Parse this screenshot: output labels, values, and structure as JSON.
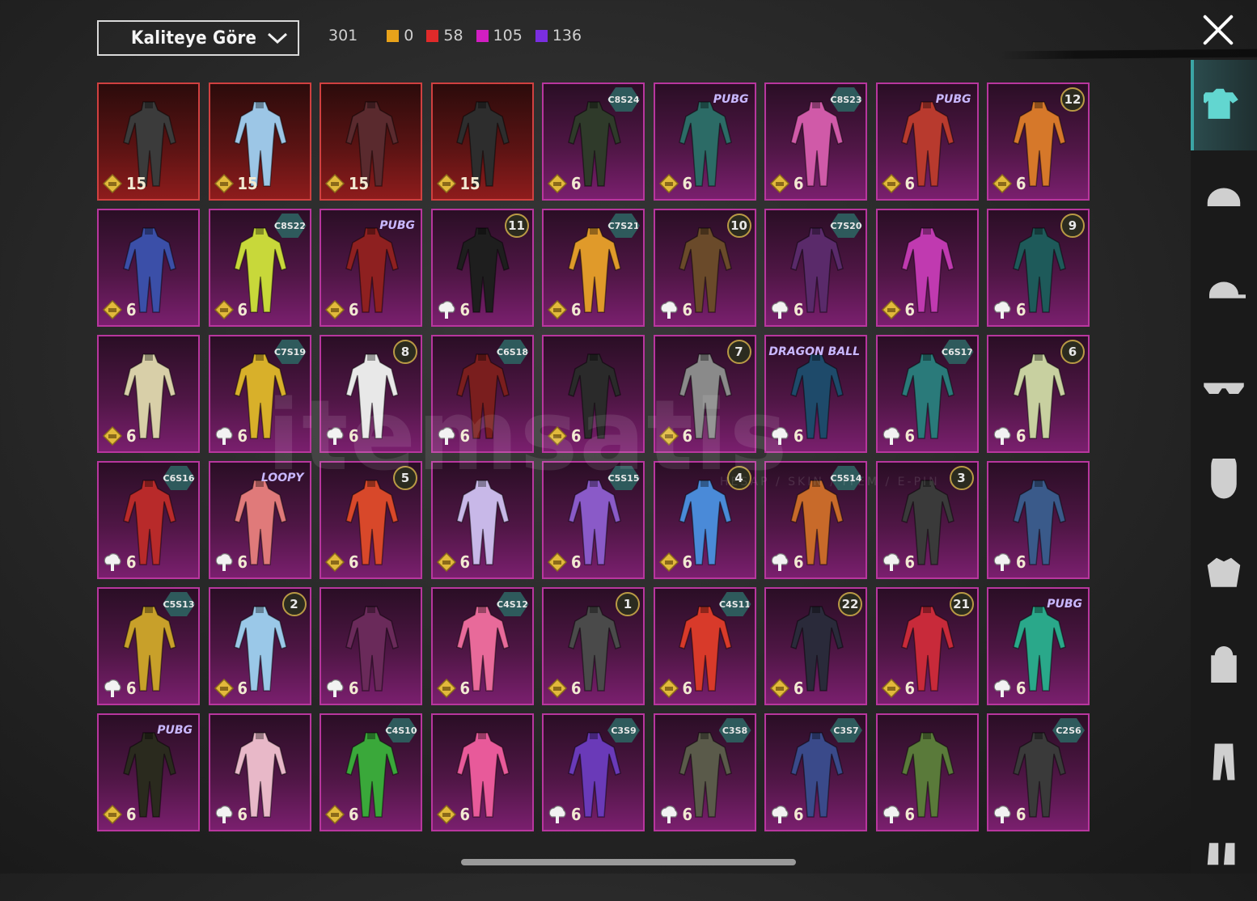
{
  "header": {
    "sort_label": "Kaliteye Göre",
    "total_count": "301",
    "counts": [
      {
        "color": "#e8a21a",
        "value": "0"
      },
      {
        "color": "#e02a2a",
        "value": "58"
      },
      {
        "color": "#d21ec2",
        "value": "105"
      },
      {
        "color": "#7a2ee0",
        "value": "136"
      }
    ]
  },
  "watermark": {
    "brand": "itemsatis",
    "tagline": "HESAP / SKIN / ITEM / E-PIN"
  },
  "categories": [
    {
      "icon": "outfit-icon",
      "active": true
    },
    {
      "icon": "helmet-icon",
      "active": false
    },
    {
      "icon": "cap-icon",
      "active": false
    },
    {
      "icon": "glasses-icon",
      "active": false
    },
    {
      "icon": "mask-icon",
      "active": false
    },
    {
      "icon": "jacket-icon",
      "active": false
    },
    {
      "icon": "backpack-icon",
      "active": false
    },
    {
      "icon": "pants-icon",
      "active": false
    },
    {
      "icon": "shoes-icon",
      "active": false
    }
  ],
  "items": [
    {
      "rarity": "red",
      "badge": "",
      "badge_type": "",
      "currency": "gold",
      "qty": "15",
      "color": "#3b3b3b"
    },
    {
      "rarity": "red",
      "badge": "",
      "badge_type": "",
      "currency": "gold",
      "qty": "15",
      "color": "#9cc6e6"
    },
    {
      "rarity": "red",
      "badge": "",
      "badge_type": "",
      "currency": "gold",
      "qty": "15",
      "color": "#5a2a2e"
    },
    {
      "rarity": "red",
      "badge": "",
      "badge_type": "",
      "currency": "gold",
      "qty": "15",
      "color": "#2d2d2d"
    },
    {
      "rarity": "purple",
      "badge": "C8S24",
      "badge_type": "season",
      "currency": "gold",
      "qty": "6",
      "color": "#2f3a2a"
    },
    {
      "rarity": "purple",
      "badge": "PUBG",
      "badge_type": "brand",
      "currency": "gold",
      "qty": "6",
      "color": "#2c6b66"
    },
    {
      "rarity": "purple",
      "badge": "C8S23",
      "badge_type": "season",
      "currency": "gold",
      "qty": "6",
      "color": "#d05aa8"
    },
    {
      "rarity": "purple",
      "badge": "PUBG",
      "badge_type": "brand",
      "currency": "gold",
      "qty": "6",
      "color": "#b83a2e"
    },
    {
      "rarity": "purple",
      "badge": "12",
      "badge_type": "num",
      "currency": "gold",
      "qty": "6",
      "color": "#d6782a"
    },
    {
      "rarity": "purple",
      "badge": "",
      "badge_type": "",
      "currency": "gold",
      "qty": "6",
      "color": "#3b4fa8"
    },
    {
      "rarity": "purple",
      "badge": "C8S22",
      "badge_type": "season",
      "currency": "gold",
      "qty": "6",
      "color": "#c8d83a"
    },
    {
      "rarity": "purple",
      "badge": "PUBG",
      "badge_type": "brand",
      "currency": "gold",
      "qty": "6",
      "color": "#8e2020"
    },
    {
      "rarity": "purple",
      "badge": "11",
      "badge_type": "num",
      "currency": "silver",
      "qty": "6",
      "color": "#1e1e1e"
    },
    {
      "rarity": "purple",
      "badge": "C7S21",
      "badge_type": "season",
      "currency": "gold",
      "qty": "6",
      "color": "#e09a2a"
    },
    {
      "rarity": "purple",
      "badge": "10",
      "badge_type": "num",
      "currency": "silver",
      "qty": "6",
      "color": "#6a4a2a"
    },
    {
      "rarity": "purple",
      "badge": "C7S20",
      "badge_type": "season",
      "currency": "silver",
      "qty": "6",
      "color": "#5a2a6a"
    },
    {
      "rarity": "purple",
      "badge": "",
      "badge_type": "",
      "currency": "gold",
      "qty": "6",
      "color": "#c03ab0"
    },
    {
      "rarity": "purple",
      "badge": "9",
      "badge_type": "num",
      "currency": "silver",
      "qty": "6",
      "color": "#1e5a5a"
    },
    {
      "rarity": "purple",
      "badge": "",
      "badge_type": "",
      "currency": "gold",
      "qty": "6",
      "color": "#d8cfa8"
    },
    {
      "rarity": "purple",
      "badge": "C7S19",
      "badge_type": "season",
      "currency": "silver",
      "qty": "6",
      "color": "#d8b02a"
    },
    {
      "rarity": "purple",
      "badge": "8",
      "badge_type": "num",
      "currency": "silver",
      "qty": "6",
      "color": "#e8e8e8"
    },
    {
      "rarity": "purple",
      "badge": "C6S18",
      "badge_type": "season",
      "currency": "silver",
      "qty": "6",
      "color": "#7a1e1e"
    },
    {
      "rarity": "purple",
      "badge": "",
      "badge_type": "",
      "currency": "gold",
      "qty": "6",
      "color": "#2a2a2a"
    },
    {
      "rarity": "purple",
      "badge": "7",
      "badge_type": "num",
      "currency": "gold",
      "qty": "6",
      "color": "#8a8a8a"
    },
    {
      "rarity": "purple",
      "badge": "DRAGON BALL",
      "badge_type": "brand",
      "currency": "silver",
      "qty": "6",
      "color": "#1e4a6a"
    },
    {
      "rarity": "purple",
      "badge": "C6S17",
      "badge_type": "season",
      "currency": "silver",
      "qty": "6",
      "color": "#2a7a7a"
    },
    {
      "rarity": "purple",
      "badge": "6",
      "badge_type": "num",
      "currency": "silver",
      "qty": "6",
      "color": "#c8d0a0"
    },
    {
      "rarity": "purple",
      "badge": "C6S16",
      "badge_type": "season",
      "currency": "silver",
      "qty": "6",
      "color": "#b82a2a"
    },
    {
      "rarity": "purple",
      "badge": "LOOPY",
      "badge_type": "brand",
      "currency": "silver",
      "qty": "6",
      "color": "#e07a7a"
    },
    {
      "rarity": "purple",
      "badge": "5",
      "badge_type": "num",
      "currency": "gold",
      "qty": "6",
      "color": "#d8482a"
    },
    {
      "rarity": "purple",
      "badge": "",
      "badge_type": "",
      "currency": "gold",
      "qty": "6",
      "color": "#c8b8e8"
    },
    {
      "rarity": "purple",
      "badge": "C5S15",
      "badge_type": "season",
      "currency": "gold",
      "qty": "6",
      "color": "#8a5ac8"
    },
    {
      "rarity": "purple",
      "badge": "4",
      "badge_type": "num",
      "currency": "gold",
      "qty": "6",
      "color": "#4a8ad8"
    },
    {
      "rarity": "purple",
      "badge": "C5S14",
      "badge_type": "season",
      "currency": "silver",
      "qty": "6",
      "color": "#c86a2a"
    },
    {
      "rarity": "purple",
      "badge": "3",
      "badge_type": "num",
      "currency": "silver",
      "qty": "6",
      "color": "#3a3a3a"
    },
    {
      "rarity": "purple",
      "badge": "",
      "badge_type": "",
      "currency": "silver",
      "qty": "6",
      "color": "#3a5a8a"
    },
    {
      "rarity": "purple",
      "badge": "C5S13",
      "badge_type": "season",
      "currency": "silver",
      "qty": "6",
      "color": "#c8a02a"
    },
    {
      "rarity": "purple",
      "badge": "2",
      "badge_type": "num",
      "currency": "gold",
      "qty": "6",
      "color": "#9ac8e8"
    },
    {
      "rarity": "purple",
      "badge": "",
      "badge_type": "",
      "currency": "silver",
      "qty": "6",
      "color": "#6a2a5a"
    },
    {
      "rarity": "purple",
      "badge": "C4S12",
      "badge_type": "season",
      "currency": "gold",
      "qty": "6",
      "color": "#e86a9a"
    },
    {
      "rarity": "purple",
      "badge": "1",
      "badge_type": "num",
      "currency": "gold",
      "qty": "6",
      "color": "#4a4a4a"
    },
    {
      "rarity": "purple",
      "badge": "C4S11",
      "badge_type": "season",
      "currency": "gold",
      "qty": "6",
      "color": "#d83a2a"
    },
    {
      "rarity": "purple",
      "badge": "22",
      "badge_type": "num",
      "currency": "gold",
      "qty": "6",
      "color": "#2a2a3a"
    },
    {
      "rarity": "purple",
      "badge": "21",
      "badge_type": "num",
      "currency": "gold",
      "qty": "6",
      "color": "#c82a3a"
    },
    {
      "rarity": "purple",
      "badge": "PUBG",
      "badge_type": "brand",
      "currency": "silver",
      "qty": "6",
      "color": "#2aa88a"
    },
    {
      "rarity": "purple",
      "badge": "PUBG",
      "badge_type": "brand",
      "currency": "gold",
      "qty": "6",
      "color": "#2a2a1e"
    },
    {
      "rarity": "purple",
      "badge": "",
      "badge_type": "",
      "currency": "silver",
      "qty": "6",
      "color": "#e8b8c8"
    },
    {
      "rarity": "purple",
      "badge": "C4S10",
      "badge_type": "season",
      "currency": "gold",
      "qty": "6",
      "color": "#3aa83a"
    },
    {
      "rarity": "purple",
      "badge": "",
      "badge_type": "",
      "currency": "gold",
      "qty": "6",
      "color": "#e85a9a"
    },
    {
      "rarity": "purple",
      "badge": "C3S9",
      "badge_type": "season",
      "currency": "silver",
      "qty": "6",
      "color": "#6a3ab8"
    },
    {
      "rarity": "purple",
      "badge": "C3S8",
      "badge_type": "season",
      "currency": "silver",
      "qty": "6",
      "color": "#5a5a4a"
    },
    {
      "rarity": "purple",
      "badge": "C3S7",
      "badge_type": "season",
      "currency": "silver",
      "qty": "6",
      "color": "#3a4a8a"
    },
    {
      "rarity": "purple",
      "badge": "",
      "badge_type": "",
      "currency": "silver",
      "qty": "6",
      "color": "#5a7a3a"
    },
    {
      "rarity": "purple",
      "badge": "C2S6",
      "badge_type": "season",
      "currency": "silver",
      "qty": "6",
      "color": "#3a3a3a"
    }
  ]
}
